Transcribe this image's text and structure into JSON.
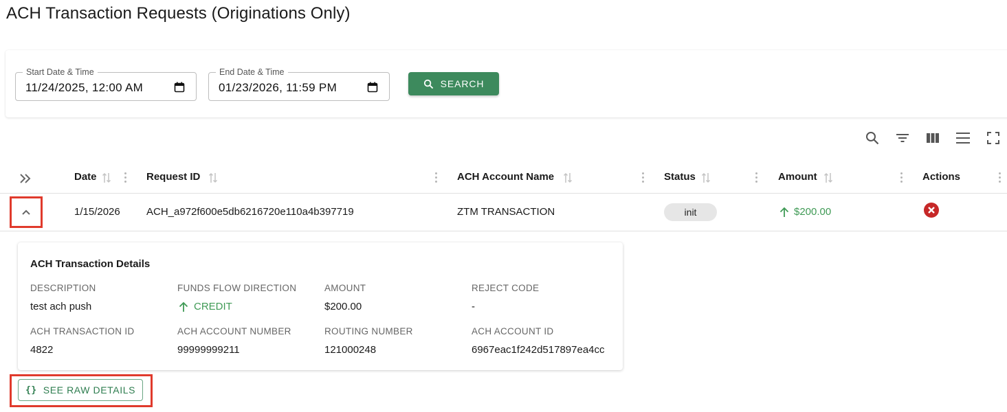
{
  "page": {
    "title": "ACH Transaction Requests (Originations Only)"
  },
  "filters": {
    "start": {
      "label": "Start Date & Time",
      "value": "11/24/2025, 12:00 AM"
    },
    "end": {
      "label": "End Date & Time",
      "value": "01/23/2026, 11:59 PM"
    },
    "search_label": "SEARCH"
  },
  "toolbar": {
    "icons": [
      "search-icon",
      "filter-icon",
      "columns-icon",
      "density-icon",
      "fullscreen-icon"
    ]
  },
  "table": {
    "columns": {
      "date": "Date",
      "request_id": "Request ID",
      "account_name": "ACH Account Name",
      "status": "Status",
      "amount": "Amount",
      "actions": "Actions"
    },
    "rows": [
      {
        "date": "1/15/2026",
        "request_id": "ACH_a972f600e5db6216720e110a4b397719",
        "account_name": "ZTM TRANSACTION",
        "status": "init",
        "amount": "$200.00"
      }
    ]
  },
  "details": {
    "title": "ACH Transaction Details",
    "description_label": "DESCRIPTION",
    "description_value": "test ach push",
    "funds_flow_label": "FUNDS FLOW DIRECTION",
    "funds_flow_value": "CREDIT",
    "amount_label": "AMOUNT",
    "amount_value": "$200.00",
    "reject_code_label": "REJECT CODE",
    "reject_code_value": "-",
    "transaction_id_label": "ACH TRANSACTION ID",
    "transaction_id_value": "4822",
    "account_number_label": "ACH ACCOUNT NUMBER",
    "account_number_value": "99999999211",
    "routing_number_label": "ROUTING NUMBER",
    "routing_number_value": "121000248",
    "account_id_label": "ACH ACCOUNT ID",
    "account_id_value": "6967eac1f242d517897ea4cc"
  },
  "raw_details": {
    "label": "SEE RAW DETAILS",
    "icon": "{}"
  },
  "colors": {
    "primary": "#3d8a5d",
    "credit": "#3f9a55",
    "cancel": "#c62828",
    "highlight": "#e03a2c"
  }
}
